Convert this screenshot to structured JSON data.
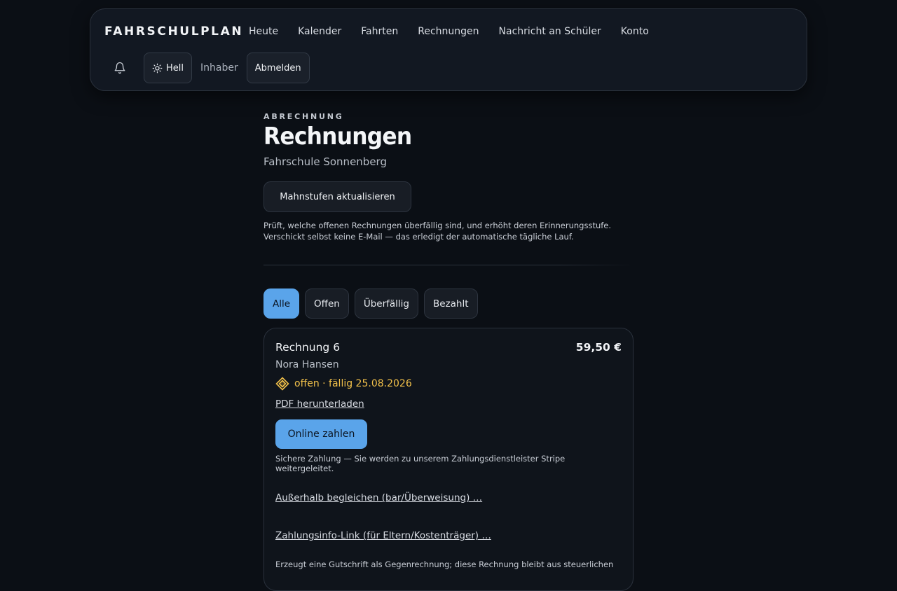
{
  "nav": {
    "brand": "FAHRSCHULPLAN",
    "links": [
      "Heute",
      "Kalender",
      "Fahrten",
      "Rechnungen",
      "Nachricht an Schüler",
      "Konto"
    ],
    "theme_label": "Hell",
    "role": "Inhaber",
    "logout_label": "Abmelden",
    "icons": {
      "notifications": "bell-icon",
      "theme": "sun-icon"
    }
  },
  "page": {
    "eyebrow": "ABRECHNUNG",
    "title": "Rechnungen",
    "subtitle": "Fahrschule Sonnenberg",
    "action_label": "Mahnstufen aktualisieren",
    "help_line1": "Prüft, welche offenen Rechnungen überfällig sind, und erhöht deren Erinnerungsstufe.",
    "help_line2": "Verschickt selbst keine E-Mail — das erledigt der automatische tägliche Lauf."
  },
  "filters": [
    "Alle",
    "Offen",
    "Überfällig",
    "Bezahlt"
  ],
  "active_filter": "Alle",
  "invoice": {
    "title": "Rechnung 6",
    "amount": "59,50 €",
    "student": "Nora Hansen",
    "status_text": "offen · fällig 25.08.2026",
    "status_icon": "diamond-icon",
    "pdf_link": "PDF herunterladen",
    "pay_button": "Online zahlen",
    "pay_note": "Sichere Zahlung — Sie werden zu unserem Zahlungsdienstleister Stripe weitergeleitet.",
    "external_link": "Außerhalb begleichen (bar/Überweisung) …",
    "info_link": "Zahlungsinfo-Link (für Eltern/Kostenträger) …",
    "credit_note": "Erzeugt eine Gutschrift als Gegenrechnung; diese Rechnung bleibt aus steuerlichen"
  },
  "colors": {
    "background": "#0b0f15",
    "accent": "#5aa4ea",
    "status_open": "#f2c14a"
  }
}
